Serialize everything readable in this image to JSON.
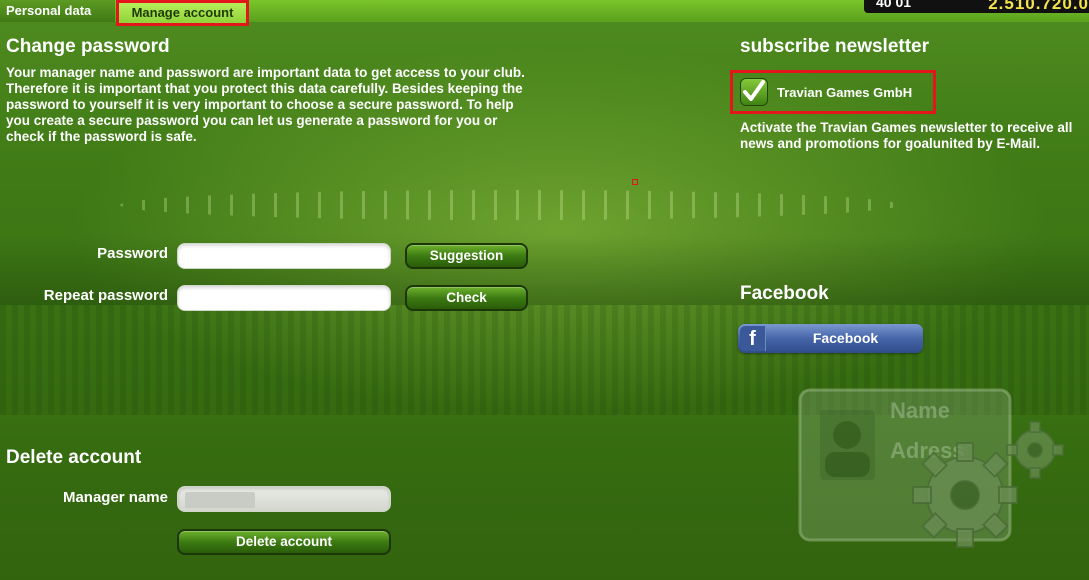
{
  "tabs": [
    {
      "label": "Personal data",
      "active": false
    },
    {
      "label": "Manage account",
      "active": true
    }
  ],
  "header": {
    "stat_left": "40 01",
    "stat_right": "2.510.720.0"
  },
  "change_password": {
    "title": "Change password",
    "description": "Your manager name and password are important data to get access to your club. Therefore it is important that you protect this data carefully. Besides keeping the password to yourself it is very important to choose a secure password. To help you create a secure password you can let us generate a password for you or check if the password is safe.",
    "password_label": "Password",
    "repeat_label": "Repeat password",
    "password_value": "",
    "repeat_value": "",
    "suggestion_button": "Suggestion",
    "check_button": "Check"
  },
  "delete_account": {
    "title": "Delete account",
    "manager_label": "Manager name",
    "button": "Delete account"
  },
  "newsletter": {
    "title": "subscribe newsletter",
    "checkbox_label": "Travian Games GmbH",
    "checked": true,
    "description": "Activate the Travian Games newsletter to receive all news and promotions for goalunited by E-Mail."
  },
  "facebook": {
    "title": "Facebook",
    "button": "Facebook",
    "icon": "facebook-icon"
  },
  "decoration": {
    "text1": "Name",
    "text2": "Adress"
  },
  "colors": {
    "highlight": "#e3161b",
    "accent": "#f3e34a",
    "facebook": "#3b5998"
  }
}
